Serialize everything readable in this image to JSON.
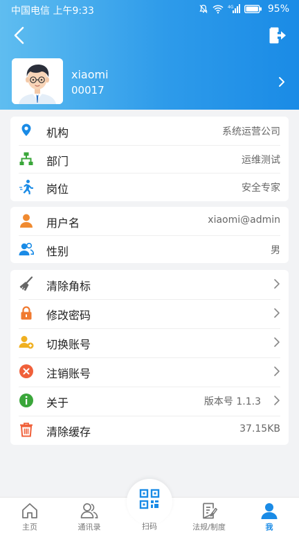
{
  "status_bar": {
    "carrier_time": "中国电信 上午9:33",
    "battery": "95%"
  },
  "header": {
    "back_icon": "chevron-left-icon",
    "logout_icon": "logout-icon"
  },
  "profile": {
    "name": "xiaomi",
    "id": "00017"
  },
  "org_info": [
    {
      "label": "机构",
      "value": "系统运营公司",
      "icon": "location-pin-icon",
      "color": "#1a8be6"
    },
    {
      "label": "部门",
      "value": "运维测试",
      "icon": "org-chart-icon",
      "color": "#3aa63a"
    },
    {
      "label": "岗位",
      "value": "安全专家",
      "icon": "runner-icon",
      "color": "#1a8be6"
    }
  ],
  "user_info": [
    {
      "label": "用户名",
      "value": "xiaomi@admin",
      "icon": "person-icon",
      "color": "#f08a30"
    },
    {
      "label": "性别",
      "value": "男",
      "icon": "users-icon",
      "color": "#1a8be6"
    }
  ],
  "actions": [
    {
      "label": "清除角标",
      "value": "",
      "icon": "broom-icon",
      "color": "#666666"
    },
    {
      "label": "修改密码",
      "value": "",
      "icon": "lock-icon",
      "color": "#f07a30"
    },
    {
      "label": "切换账号",
      "value": "",
      "icon": "switch-user-icon",
      "color": "#f0b020"
    },
    {
      "label": "注销账号",
      "value": "",
      "icon": "close-circle-icon",
      "color": "#f0603a"
    },
    {
      "label": "关于",
      "value": "版本号 1.1.3",
      "icon": "info-icon",
      "color": "#3aa63a"
    },
    {
      "label": "清除缓存",
      "value": "37.15KB",
      "icon": "trash-icon",
      "color": "#f0603a"
    }
  ],
  "tabbar": {
    "tabs": [
      {
        "label": "主页",
        "icon": "home-icon"
      },
      {
        "label": "通讯录",
        "icon": "contacts-icon"
      },
      {
        "label": "扫码",
        "icon": "qr-code-icon"
      },
      {
        "label": "法规/制度",
        "icon": "document-icon"
      },
      {
        "label": "我",
        "icon": "me-icon"
      }
    ],
    "active_color": "#1a8be6"
  }
}
